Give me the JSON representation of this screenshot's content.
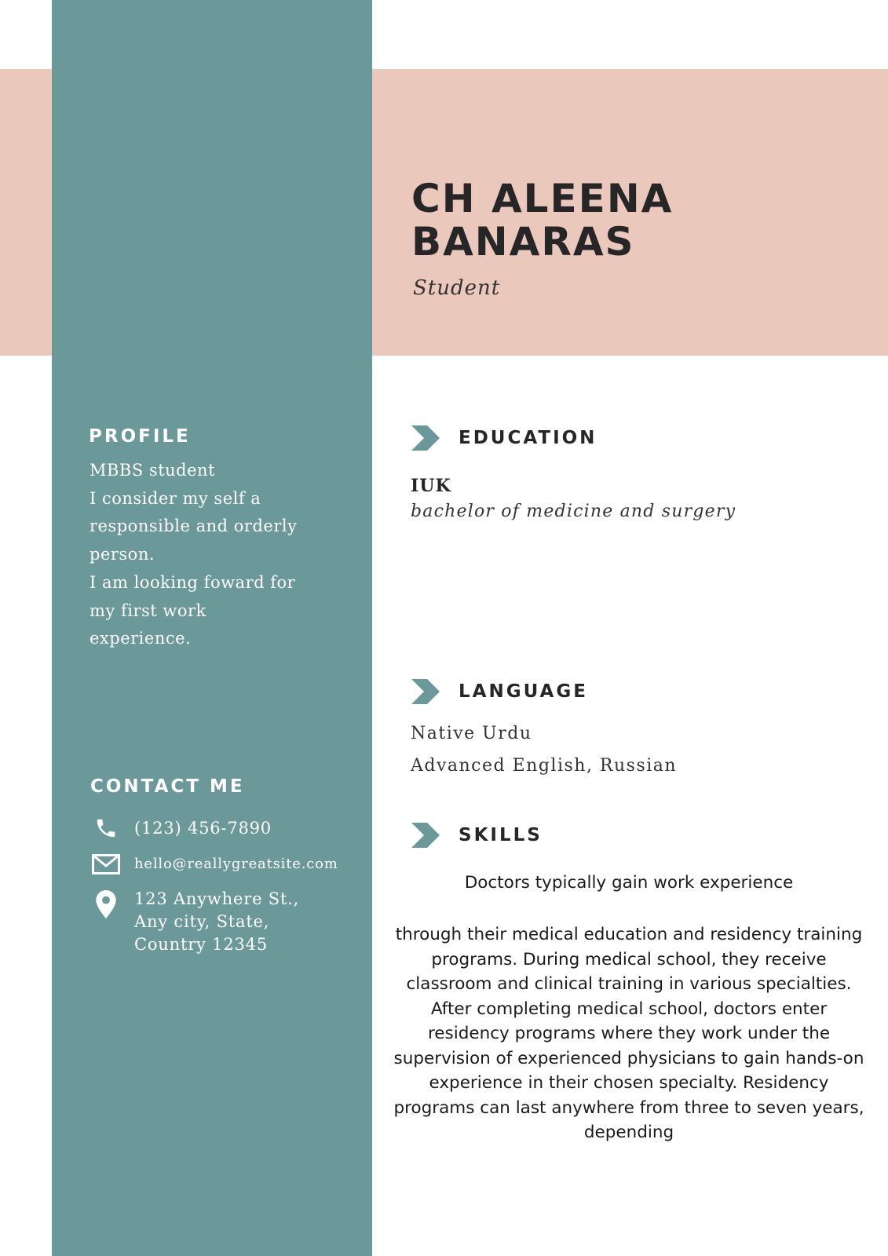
{
  "colors": {
    "sidebar": "#6b9898",
    "band": "#eac8bb",
    "heading_text": "#262626",
    "chevron": "#6b9898"
  },
  "header": {
    "name_lines": [
      "CH ALEENA",
      "BANARAS"
    ],
    "role": "Student"
  },
  "sidebar": {
    "profile": {
      "heading": "PROFILE",
      "lines": [
        "MBBS student",
        "I consider my self a",
        "responsible and orderly",
        "person.",
        "I am looking foward for",
        "my first work",
        "experience."
      ]
    },
    "contact": {
      "heading": "CONTACT ME",
      "phone": "(123) 456-7890",
      "email": "hello@reallygreatsite.com",
      "address_lines": [
        "123 Anywhere St.,",
        "Any city, State,",
        "Country 12345"
      ],
      "icons": [
        "phone-icon",
        "envelope-icon",
        "map-pin-icon"
      ]
    }
  },
  "education": {
    "heading": "EDUCATION",
    "school": "IUK",
    "degree": "bachelor of medicine and surgery"
  },
  "language": {
    "heading": "LANGUAGE",
    "items": [
      "Native Urdu",
      "Advanced English, Russian"
    ]
  },
  "skills": {
    "heading": "SKILLS",
    "intro": "Doctors typically gain work experience",
    "body_lines": [
      "through their medical education and residency training",
      "programs. During medical school, they receive",
      "classroom and clinical training in various specialties.",
      "After completing medical school, doctors enter",
      "residency programs where they work under the",
      "supervision of experienced physicians to gain hands-on",
      "experience in their chosen specialty. Residency",
      "programs can last anywhere from three to seven years,",
      "depending"
    ]
  }
}
